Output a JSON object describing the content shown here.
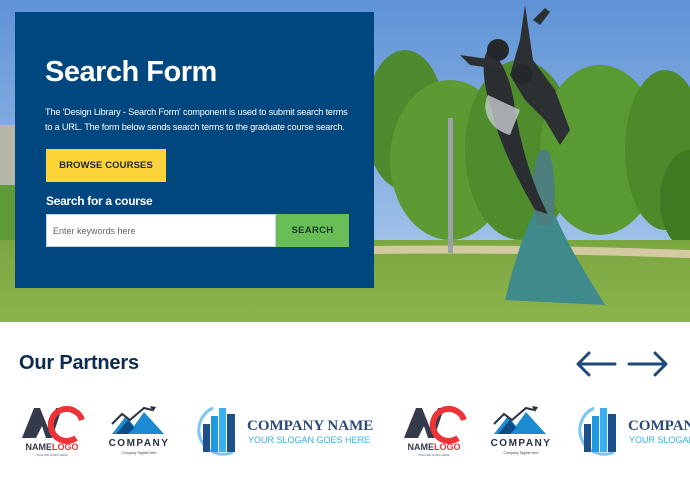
{
  "hero": {
    "title": "Search Form",
    "description": "The 'Design Library - Search Form' component is used to submit search terms to a URL. The form below sends search terms to the graduate course search.",
    "browse_button": "BROWSE COURSES",
    "search_label": "Search for a course",
    "search_placeholder": "Enter keywords here",
    "search_value": "",
    "search_button": "SEARCH",
    "image_alt": "Bronze sculpture of two dancers in a park"
  },
  "partners": {
    "title": "Our Partners",
    "prev_icon": "arrow-left-icon",
    "next_icon": "arrow-right-icon",
    "logos": [
      {
        "kind": "namelogo",
        "name": "NAMELOGO",
        "name_a": "NAME",
        "name_b": "LOGO",
        "tagline": "TAGLINE GOES HERE"
      },
      {
        "kind": "company",
        "name": "COMPANY",
        "tagline": "Company Tagline here"
      },
      {
        "kind": "companyname",
        "name": "COMPANY NAME",
        "tagline": "YOUR SLOGAN GOES HERE"
      },
      {
        "kind": "namelogo",
        "name": "NAMELOGO",
        "name_a": "NAME",
        "name_b": "LOGO",
        "tagline": "TAGLINE GOES HERE"
      },
      {
        "kind": "company",
        "name": "COMPANY",
        "tagline": "Company Tagline here"
      },
      {
        "kind": "companyname",
        "name": "COMPANY NAME",
        "tagline": "YOUR SLOGAN GOES HERE"
      }
    ]
  },
  "colors": {
    "panel_bg": "#00467f",
    "browse_bg": "#fdd33a",
    "search_bg": "#69bf55",
    "heading": "#0d2a4f"
  }
}
